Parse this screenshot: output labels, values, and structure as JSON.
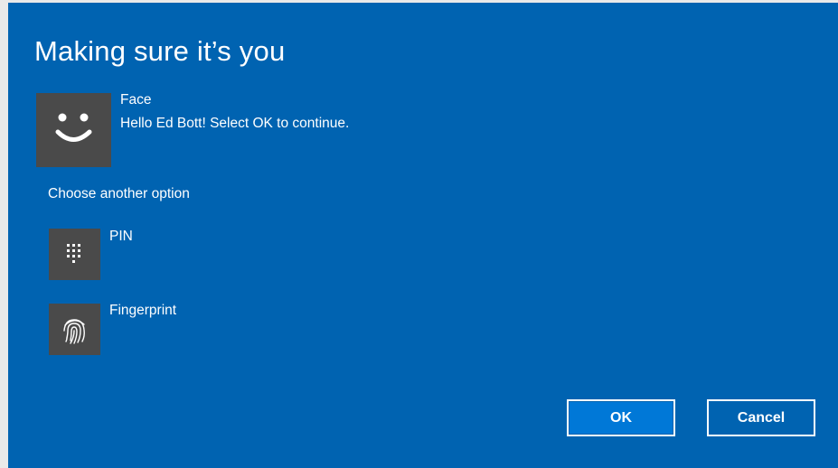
{
  "dialog": {
    "title": "Making sure it’s you",
    "background_color": "#0063b1"
  },
  "face": {
    "icon": "smiley-face-icon",
    "label": "Face",
    "message": "Hello Ed Bott! Select OK to continue."
  },
  "other_options": {
    "heading": "Choose another option",
    "options": [
      {
        "label": "PIN",
        "icon": "pin-keypad-icon"
      },
      {
        "label": "Fingerprint",
        "icon": "fingerprint-icon"
      }
    ]
  },
  "buttons": {
    "ok_label": "OK",
    "cancel_label": "Cancel",
    "ok_color": "#0078d7"
  }
}
